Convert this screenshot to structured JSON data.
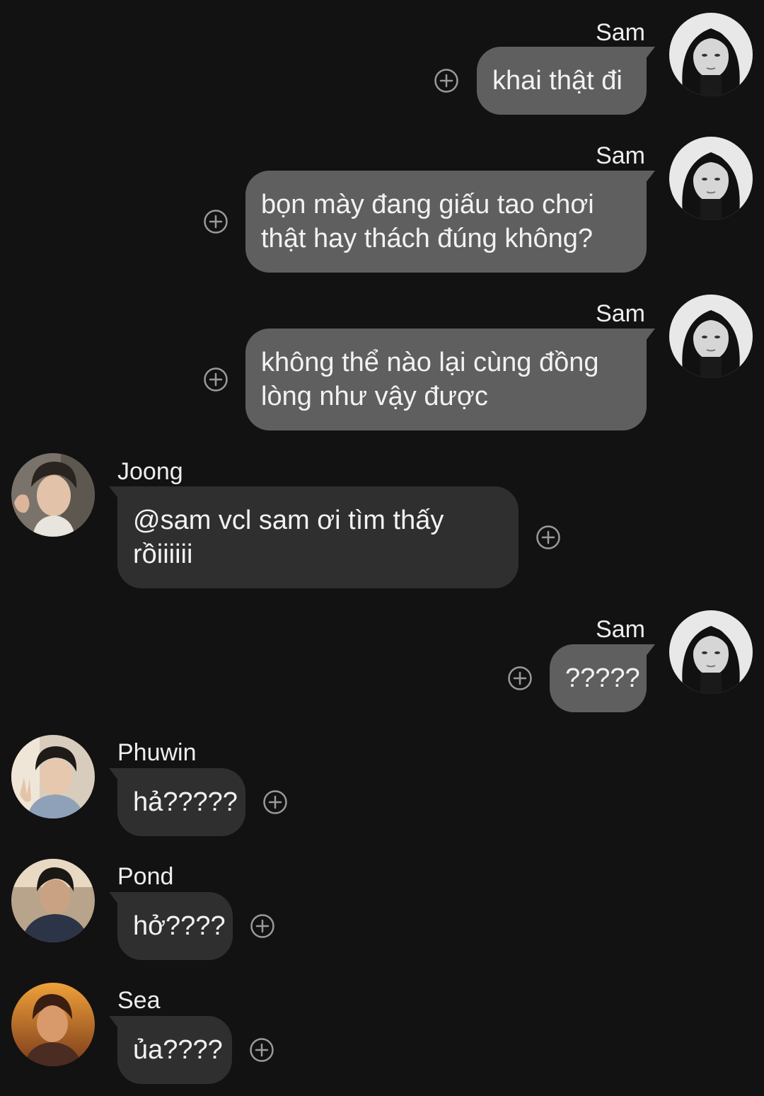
{
  "messages": [
    {
      "sender": "Sam",
      "text": "khai thật đi",
      "direction": "out",
      "avatar": "sam-avatar"
    },
    {
      "sender": "Sam",
      "text": "bọn mày đang giấu tao chơi thật hay thách đúng không?",
      "direction": "out",
      "avatar": "sam-avatar"
    },
    {
      "sender": "Sam",
      "text": "không thể nào lại cùng đồng lòng như vậy được",
      "direction": "out",
      "avatar": "sam-avatar"
    },
    {
      "sender": "Joong",
      "text": "@sam vcl sam ơi tìm thấy rồiiiiii",
      "direction": "in",
      "avatar": "joong-avatar"
    },
    {
      "sender": "Sam",
      "text": "?????",
      "direction": "out",
      "avatar": "sam-avatar"
    },
    {
      "sender": "Phuwin",
      "text": "hả?????",
      "direction": "in",
      "avatar": "phuwin-avatar"
    },
    {
      "sender": "Pond",
      "text": "hở????",
      "direction": "in",
      "avatar": "pond-avatar"
    },
    {
      "sender": "Sea",
      "text": "ủa????",
      "direction": "in",
      "avatar": "sea-avatar"
    }
  ],
  "icons": {
    "reaction": "add-reaction-icon"
  },
  "colors": {
    "background": "#121212",
    "outgoing_bubble": "#5f5f5f",
    "incoming_bubble": "#2f2f2f",
    "text": "#f2f2f2"
  }
}
